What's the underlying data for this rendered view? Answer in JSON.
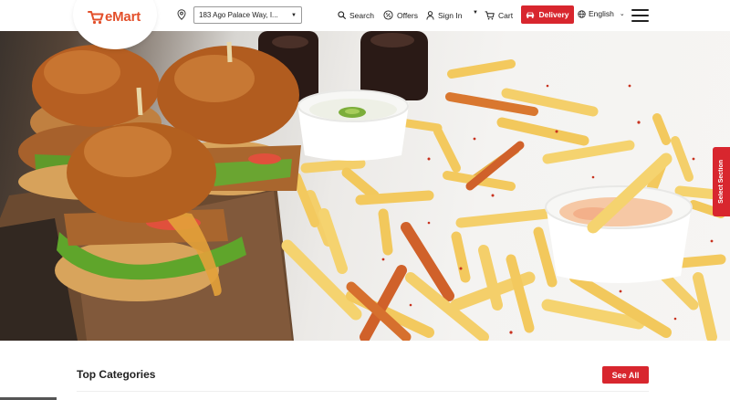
{
  "header": {
    "logo_text": "eMart",
    "location": {
      "address": "183 Ago Palace Way, I...",
      "icon": "location-pin-icon"
    },
    "nav": {
      "search": "Search",
      "offers": "Offers",
      "signin": "Sign In",
      "cart": "Cart"
    },
    "delivery_button": "Delivery",
    "language": "English",
    "menu_icon": "hamburger-menu-icon"
  },
  "hero": {
    "image_alt": "Chicken burgers with french fries and dipping sauces"
  },
  "side_tab": {
    "label": "Select Section"
  },
  "categories": {
    "title": "Top Categories",
    "see_all": "See All"
  },
  "colors": {
    "brand": "#e3502b",
    "accent_red": "#d8262e",
    "text_dark": "#222222"
  }
}
